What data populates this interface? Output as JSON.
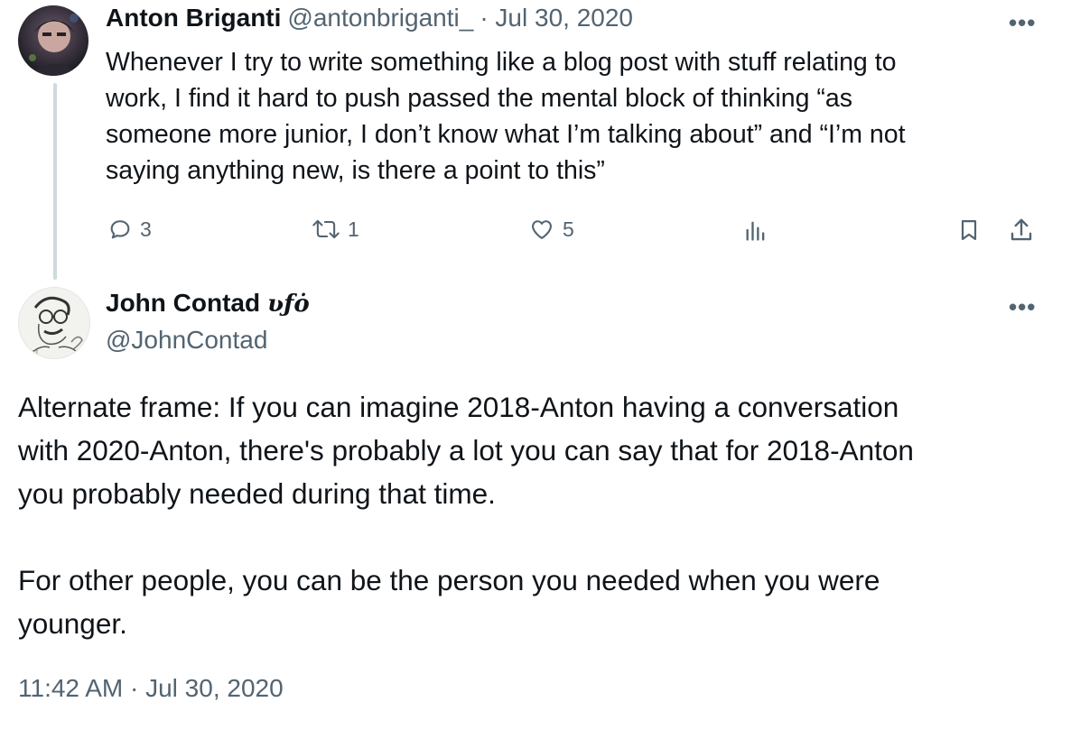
{
  "reply_parent": {
    "display_name": "Anton Briganti",
    "handle": "@antonbriganti_",
    "date": "· Jul 30, 2020",
    "text": "Whenever I try to write something like a blog post with stuff relating to\nwork, I find it hard to push passed the mental block of thinking “as\nsomeone more junior, I don’t know what I’m talking about” and “I’m not\nsaying anything new, is there a point to this”",
    "replies": "3",
    "retweets": "1",
    "likes": "5",
    "more_label": "•••"
  },
  "main_tweet": {
    "display_name": "John Contad",
    "name_glyphs": "ʋƒȯ",
    "handle": "@JohnContad",
    "text": "Alternate frame: If you can imagine 2018-Anton having a conversation\nwith 2020-Anton, there's probably a lot you can say that for 2018-Anton\nyou probably needed during that time.\n\nFor other people, you can be the person you needed when you were\nyounger.",
    "timestamp": "11:42 AM · Jul 30, 2020",
    "more_label": "•••"
  }
}
